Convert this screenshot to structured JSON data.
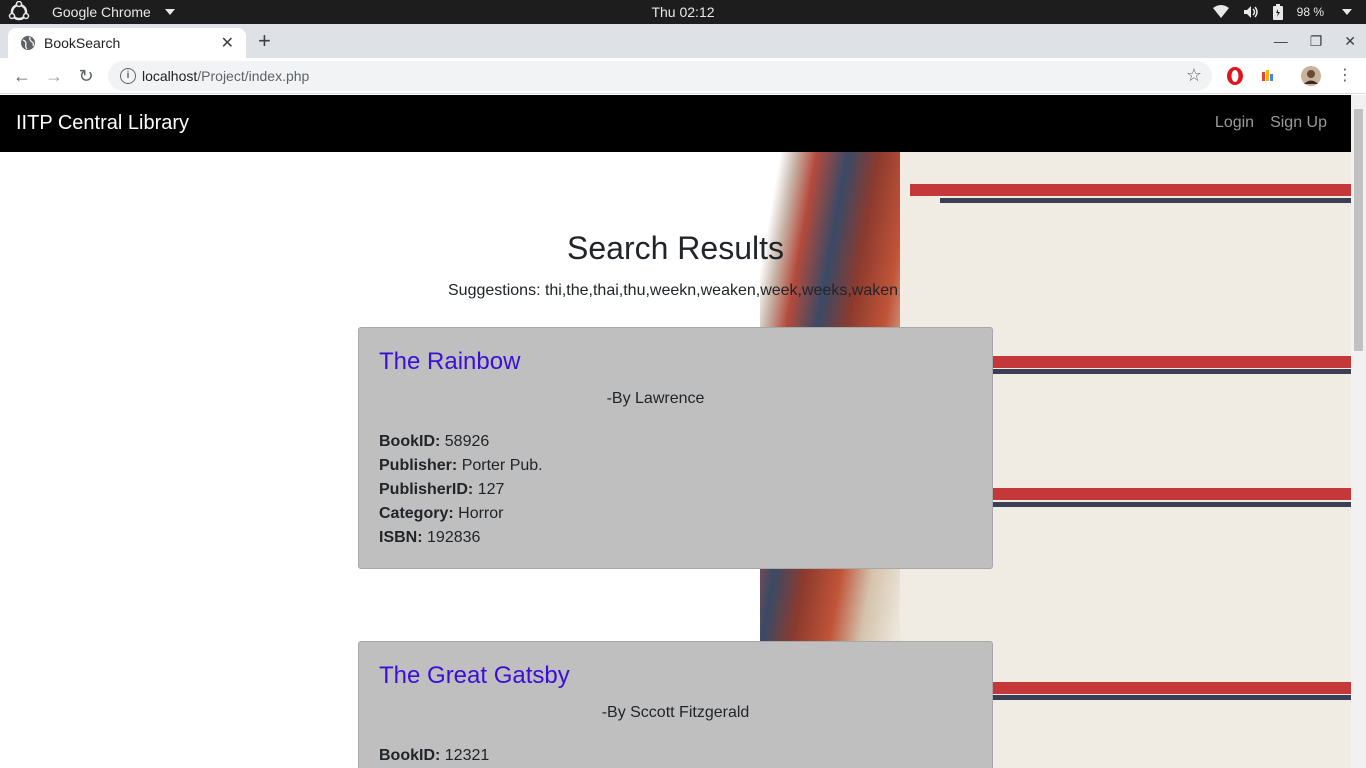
{
  "os_bar": {
    "app_name": "Google Chrome",
    "clock": "Thu 02:12",
    "battery": "98 %"
  },
  "browser": {
    "tab_title": "BookSearch",
    "url_host": "localhost",
    "url_path": "/Project/index.php"
  },
  "navbar": {
    "brand": "IITP Central Library",
    "login": "Login",
    "signup": "Sign Up"
  },
  "results": {
    "heading": "Search Results",
    "suggestions": "Suggestions: thi,the,thai,thu,weekn,weaken,week,weeks,waken"
  },
  "books": [
    {
      "title": "The Rainbow",
      "author": "-By Lawrence",
      "fields": [
        {
          "label": "BookID:",
          "value": "58926"
        },
        {
          "label": "Publisher:",
          "value": "Porter Pub."
        },
        {
          "label": "PublisherID:",
          "value": "127"
        },
        {
          "label": "Category:",
          "value": "Horror"
        },
        {
          "label": "ISBN:",
          "value": "192836"
        }
      ]
    },
    {
      "title": "The Great Gatsby",
      "author": "-By Sccott Fitzgerald",
      "fields": [
        {
          "label": "BookID:",
          "value": "12321"
        }
      ]
    }
  ],
  "colors": {
    "link": "#3c0fd6",
    "card_bg": "#bfbfbf",
    "navbar_bg": "#000000"
  }
}
